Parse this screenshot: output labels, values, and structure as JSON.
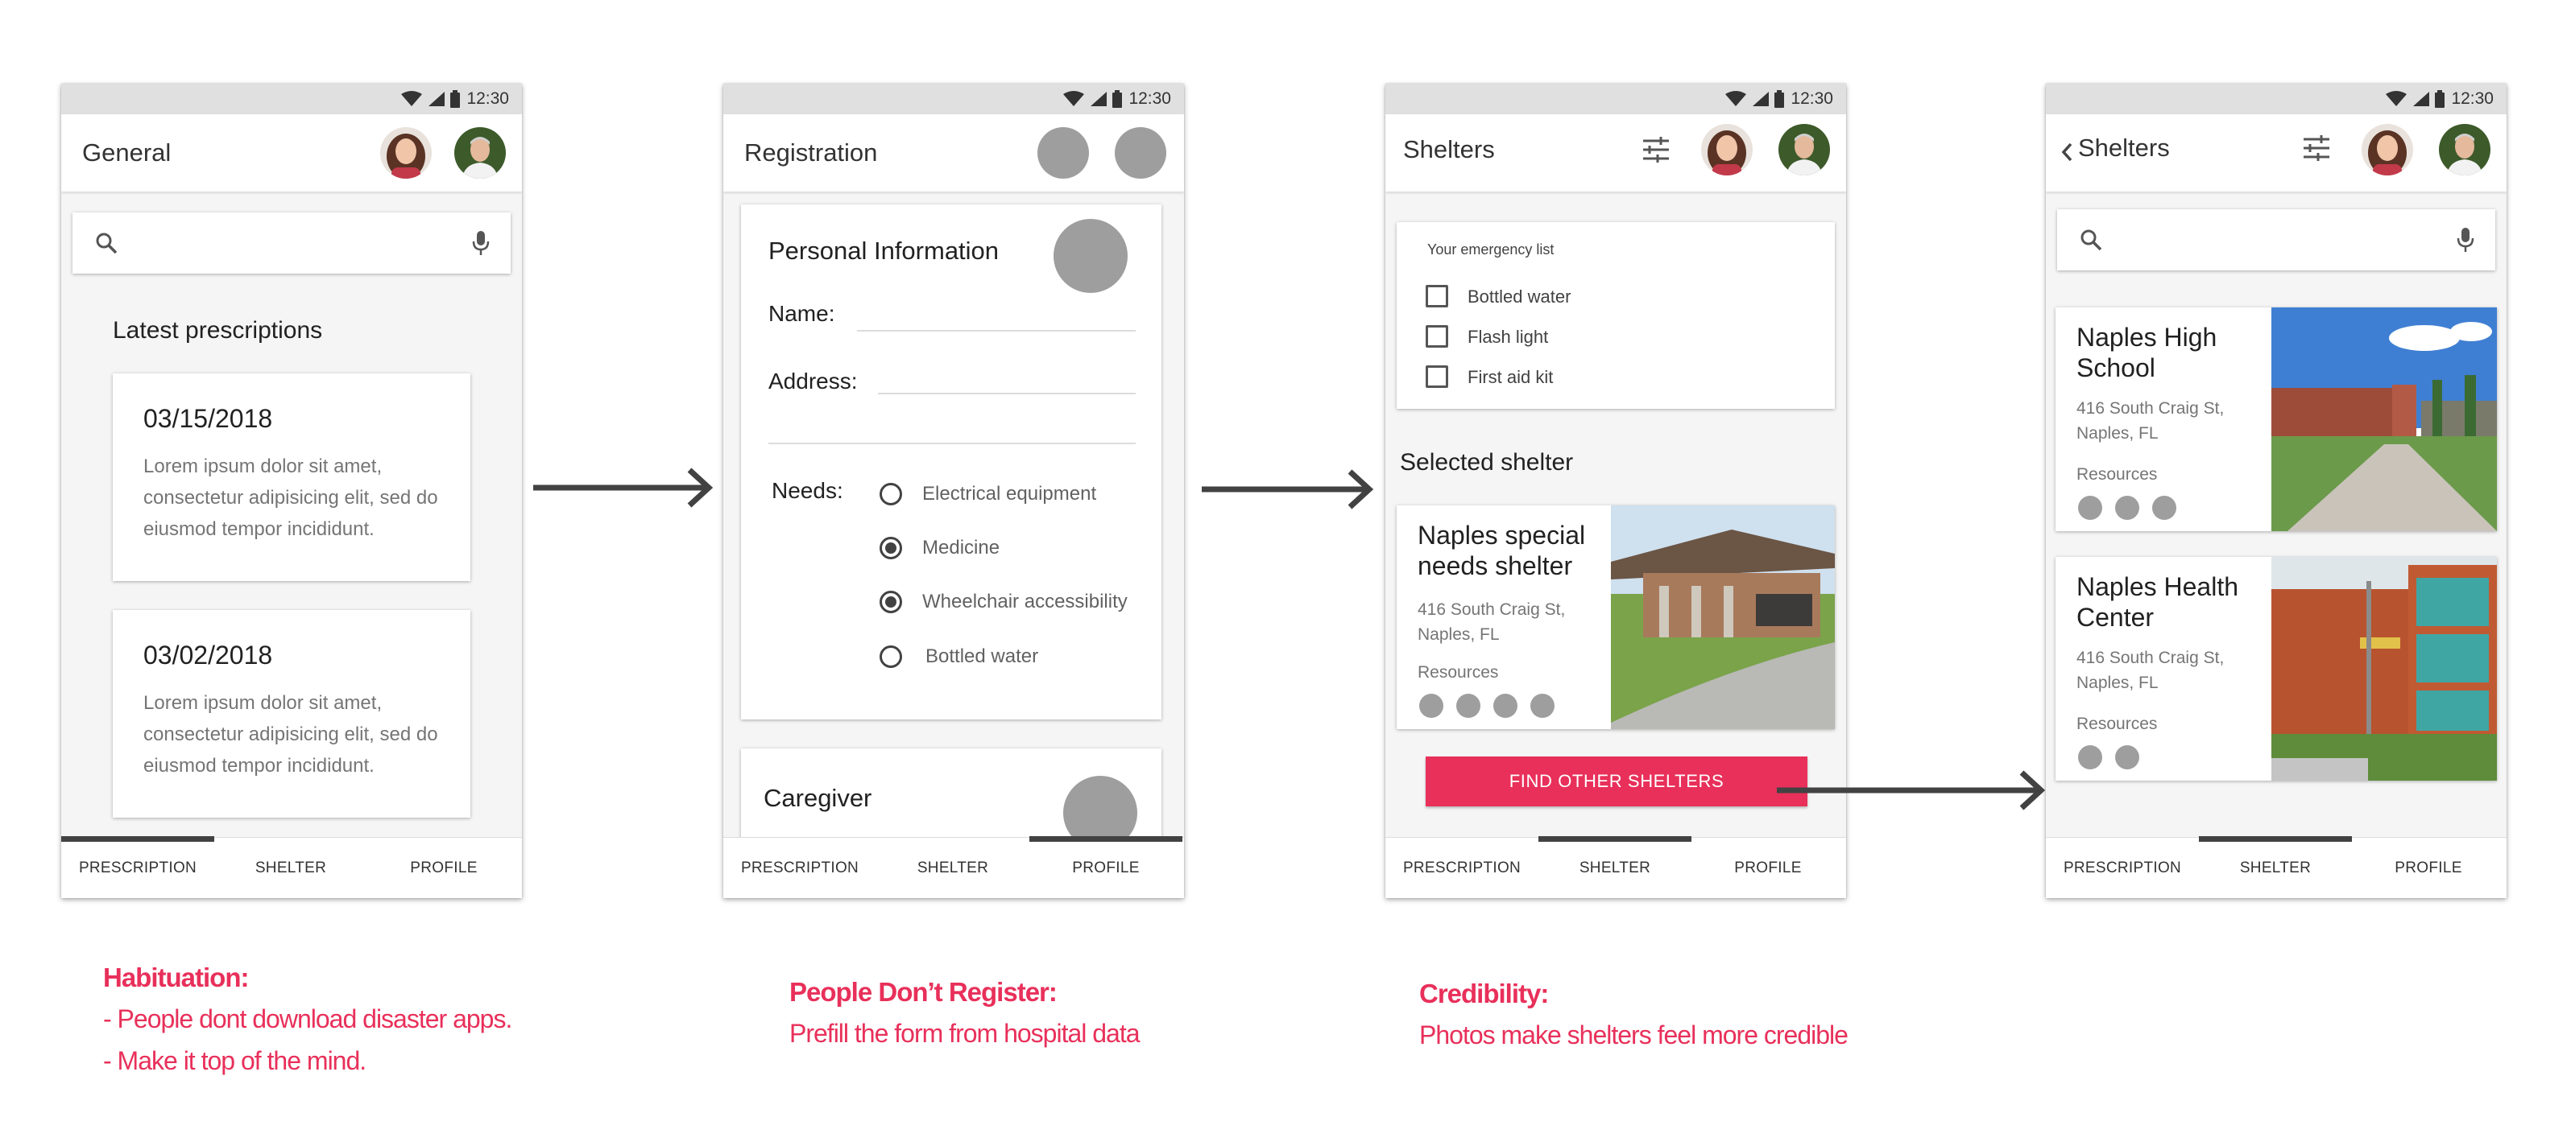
{
  "status": {
    "time": "12:30"
  },
  "nav": {
    "prescription": "PRESCRIPTION",
    "shelter": "SHELTER",
    "profile": "PROFILE"
  },
  "screen1": {
    "title": "General",
    "section_title": "Latest prescriptions",
    "prescriptions": [
      {
        "date": "03/15/2018",
        "text": "Lorem ipsum dolor sit amet, consectetur adipisicing elit, sed do eiusmod tempor incididunt."
      },
      {
        "date": "03/02/2018",
        "text": "Lorem ipsum dolor sit amet, consectetur adipisicing elit, sed do eiusmod tempor incididunt."
      }
    ]
  },
  "screen2": {
    "title": "Registration",
    "form_title": "Personal Information",
    "name_label": "Name:",
    "address_label": "Address:",
    "needs_label": "Needs:",
    "needs": [
      {
        "label": "Electrical equipment",
        "selected": false
      },
      {
        "label": "Medicine",
        "selected": true
      },
      {
        "label": "Wheelchair accessibility",
        "selected": true
      },
      {
        "label": "Bottled water",
        "selected": false
      }
    ],
    "caregiver_title": "Caregiver"
  },
  "screen3": {
    "title": "Shelters",
    "list_title": "Your emergency list",
    "list_items": [
      "Bottled water",
      "Flash light",
      "First aid kit"
    ],
    "selected_title": "Selected shelter",
    "shelter": {
      "name": "Naples special needs shelter",
      "address": "416 South Craig St, Naples, FL",
      "resources_label": "Resources",
      "resource_count": 4
    },
    "button_label": "FIND OTHER SHELTERS"
  },
  "screen4": {
    "title": "Shelters",
    "shelters": [
      {
        "name": "Naples High School",
        "address": "416 South Craig St, Naples, FL",
        "resources_label": "Resources",
        "resource_count": 3
      },
      {
        "name": "Naples Health Center",
        "address": "416 South Craig St, Naples, FL",
        "resources_label": "Resources",
        "resource_count": 2
      }
    ]
  },
  "notes": [
    {
      "title": "Habituation:",
      "lines": [
        "- People dont download disaster apps.",
        "- Make it top of the mind."
      ]
    },
    {
      "title": "People Don’t Register:",
      "lines": [
        "Prefill the form from hospital data"
      ]
    },
    {
      "title": "Credibility:",
      "lines": [
        "Photos make shelters feel more credible"
      ]
    }
  ],
  "colors": {
    "accent": "#e8305a",
    "arrow": "#424242"
  }
}
